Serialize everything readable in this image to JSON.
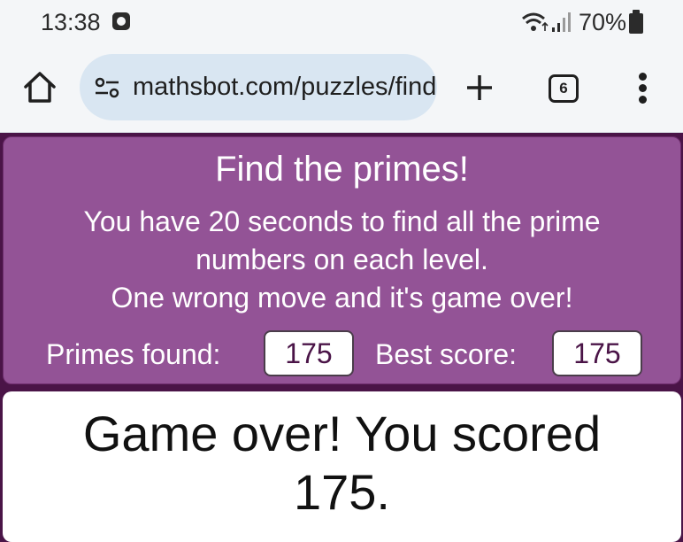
{
  "status_bar": {
    "time": "13:38",
    "battery_percent": "70%"
  },
  "browser": {
    "url": "mathsbot.com/puzzles/find-the-primes",
    "tab_count": "6"
  },
  "game": {
    "title": "Find the primes!",
    "description": "You have 20 seconds to find all the prime numbers on each level.",
    "warning": "One wrong move and it's game over!",
    "primes_found_label": "Primes found:",
    "primes_found_value": "175",
    "best_score_label": "Best score:",
    "best_score_value": "175",
    "result_message": "Game over! You scored 175."
  },
  "colors": {
    "panel_purple": "#935396",
    "page_background": "#4a1447"
  }
}
